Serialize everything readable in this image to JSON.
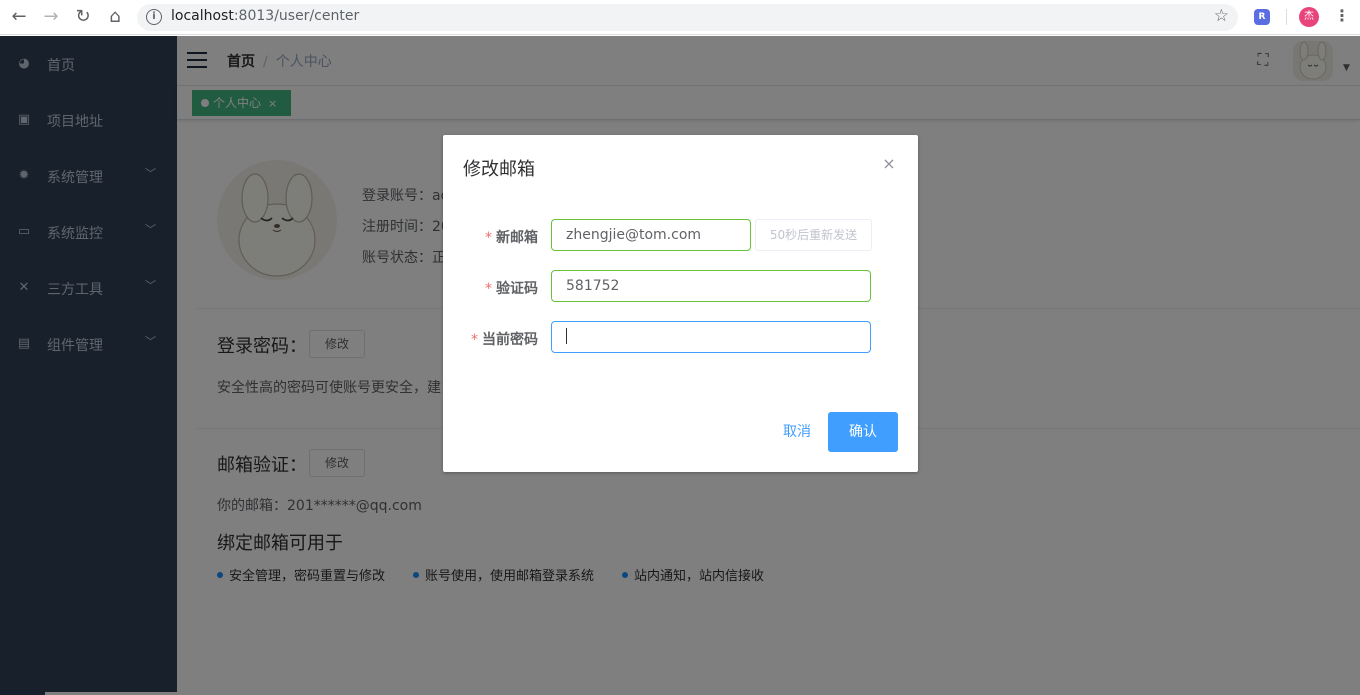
{
  "browser": {
    "url_host": "localhost",
    "url_rest": ":8013/user/center",
    "profile_initial": "杰",
    "ext_label": "R"
  },
  "sidebar": {
    "items": [
      {
        "label": "首页",
        "icon": "dashboard-icon",
        "glyph": "◕",
        "has_arrow": false
      },
      {
        "label": "项目地址",
        "icon": "github-icon",
        "glyph": "▣",
        "has_arrow": false
      },
      {
        "label": "系统管理",
        "icon": "gear-icon",
        "glyph": "✹",
        "has_arrow": true
      },
      {
        "label": "系统监控",
        "icon": "monitor-icon",
        "glyph": "▭",
        "has_arrow": true
      },
      {
        "label": "三方工具",
        "icon": "tools-icon",
        "glyph": "✕",
        "has_arrow": true
      },
      {
        "label": "组件管理",
        "icon": "component-icon",
        "glyph": "▤",
        "has_arrow": true
      }
    ]
  },
  "breadcrumb": {
    "home": "首页",
    "current": "个人中心"
  },
  "tags": [
    {
      "label": "个人中心",
      "close": "×"
    }
  ],
  "profile": {
    "rows": [
      "登录账号：ad",
      "注册时间：20",
      "账号状态：正"
    ]
  },
  "password_section": {
    "title": "登录密码：",
    "button": "修改",
    "desc": "安全性高的密码可使账号更安全，建"
  },
  "email_section": {
    "title": "邮箱验证：",
    "button": "修改",
    "email_text": "你的邮箱：201******@qq.com",
    "usage_title": "绑定邮箱可用于",
    "usages": [
      "安全管理，密码重置与修改",
      "账号使用，使用邮箱登录系统",
      "站内通知，站内信接收"
    ]
  },
  "dialog": {
    "title": "修改邮箱",
    "close": "×",
    "fields": [
      {
        "label": "新邮箱",
        "value": "zhengjie@tom.com"
      },
      {
        "label": "验证码",
        "value": "581752"
      },
      {
        "label": "当前密码",
        "value": ""
      }
    ],
    "resend_label": "50秒后重新发送",
    "cancel_label": "取消",
    "confirm_label": "确认"
  },
  "colors": {
    "sidebar_bg": "#304156",
    "primary": "#409eff",
    "tag_green": "#42b983",
    "success": "#67c23a",
    "danger": "#f56c6c"
  }
}
